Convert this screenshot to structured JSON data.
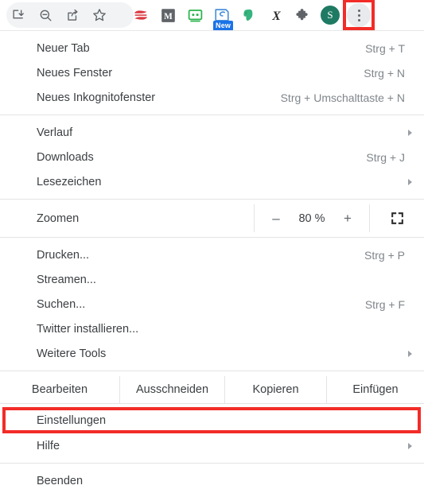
{
  "toolbar": {
    "icons": [
      {
        "name": "download-icon",
        "title": "Downloads"
      },
      {
        "name": "zoom-out-icon",
        "title": "Zoom out"
      },
      {
        "name": "share-icon",
        "title": "Share"
      },
      {
        "name": "bookmark-star-icon",
        "title": "Bookmark"
      }
    ],
    "extensions": [
      {
        "name": "express-vpn-icon",
        "title": "ExpressVPN"
      },
      {
        "name": "mendeley-icon",
        "title": "M",
        "letter": "M"
      },
      {
        "name": "robot-extension-icon",
        "title": "Robot"
      },
      {
        "name": "scanner-extension-icon",
        "title": "Scanner",
        "badge": "New"
      },
      {
        "name": "evernote-icon",
        "title": "Evernote"
      },
      {
        "name": "italic-x-icon",
        "title": "X",
        "letter": "X"
      },
      {
        "name": "puzzle-extensions-icon",
        "title": "Extensions"
      }
    ],
    "avatar_letter": "S",
    "menu_button": "chrome-menu-button"
  },
  "menu": {
    "groups": [
      {
        "items": [
          {
            "label": "Neuer Tab",
            "accel": "Strg + T",
            "submenu": false,
            "name": "menu-item-new-tab"
          },
          {
            "label": "Neues Fenster",
            "accel": "Strg + N",
            "submenu": false,
            "name": "menu-item-new-window"
          },
          {
            "label": "Neues Inkognitofenster",
            "accel": "Strg + Umschalttaste + N",
            "submenu": false,
            "name": "menu-item-new-incognito-window"
          }
        ]
      },
      {
        "items": [
          {
            "label": "Verlauf",
            "accel": "",
            "submenu": true,
            "name": "menu-item-history"
          },
          {
            "label": "Downloads",
            "accel": "Strg + J",
            "submenu": false,
            "name": "menu-item-downloads"
          },
          {
            "label": "Lesezeichen",
            "accel": "",
            "submenu": true,
            "name": "menu-item-bookmarks"
          }
        ]
      },
      {
        "items": [
          {
            "label": "Drucken...",
            "accel": "Strg + P",
            "submenu": false,
            "name": "menu-item-print"
          },
          {
            "label": "Streamen...",
            "accel": "",
            "submenu": false,
            "name": "menu-item-cast"
          },
          {
            "label": "Suchen...",
            "accel": "Strg + F",
            "submenu": false,
            "name": "menu-item-find"
          },
          {
            "label": "Twitter installieren...",
            "accel": "",
            "submenu": false,
            "name": "menu-item-install-twitter"
          },
          {
            "label": "Weitere Tools",
            "accel": "",
            "submenu": true,
            "name": "menu-item-more-tools"
          }
        ]
      }
    ],
    "zoom": {
      "label": "Zoomen",
      "minus": "–",
      "value": "80 %",
      "plus": "+",
      "fullscreen_icon": "fullscreen-icon"
    },
    "edit": {
      "label": "Bearbeiten",
      "cut": "Ausschneiden",
      "copy": "Kopieren",
      "paste": "Einfügen"
    },
    "settings": {
      "label": "Einstellungen",
      "highlighted": true
    },
    "help": {
      "label": "Hilfe",
      "submenu": true
    },
    "exit": {
      "label": "Beenden"
    }
  },
  "colors": {
    "highlight_red": "#f22c28",
    "accent_blue": "#1a73e8",
    "avatar_teal": "#1f7a63",
    "text": "#3c4043",
    "muted_text": "#80868b"
  }
}
